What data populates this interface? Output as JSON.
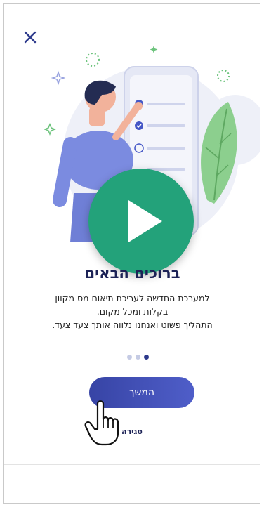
{
  "dialog": {
    "close_icon": "close-icon",
    "play_icon": "play-icon",
    "title": "ברוכים הבאים",
    "description_lines": [
      "למערכת החדשה לעריכת תיאום מס מקוון",
      "בקלות ומכל מקום.",
      "התהליך פשוט ואנחנו נלווה אותך צעד צעד."
    ],
    "pagination": {
      "total": 3,
      "current": 3
    },
    "continue_label": "המשך",
    "close_label": "סגירה",
    "colors": {
      "primary": "#3744a5",
      "accent": "#23a27a",
      "title": "#1c2256"
    }
  }
}
